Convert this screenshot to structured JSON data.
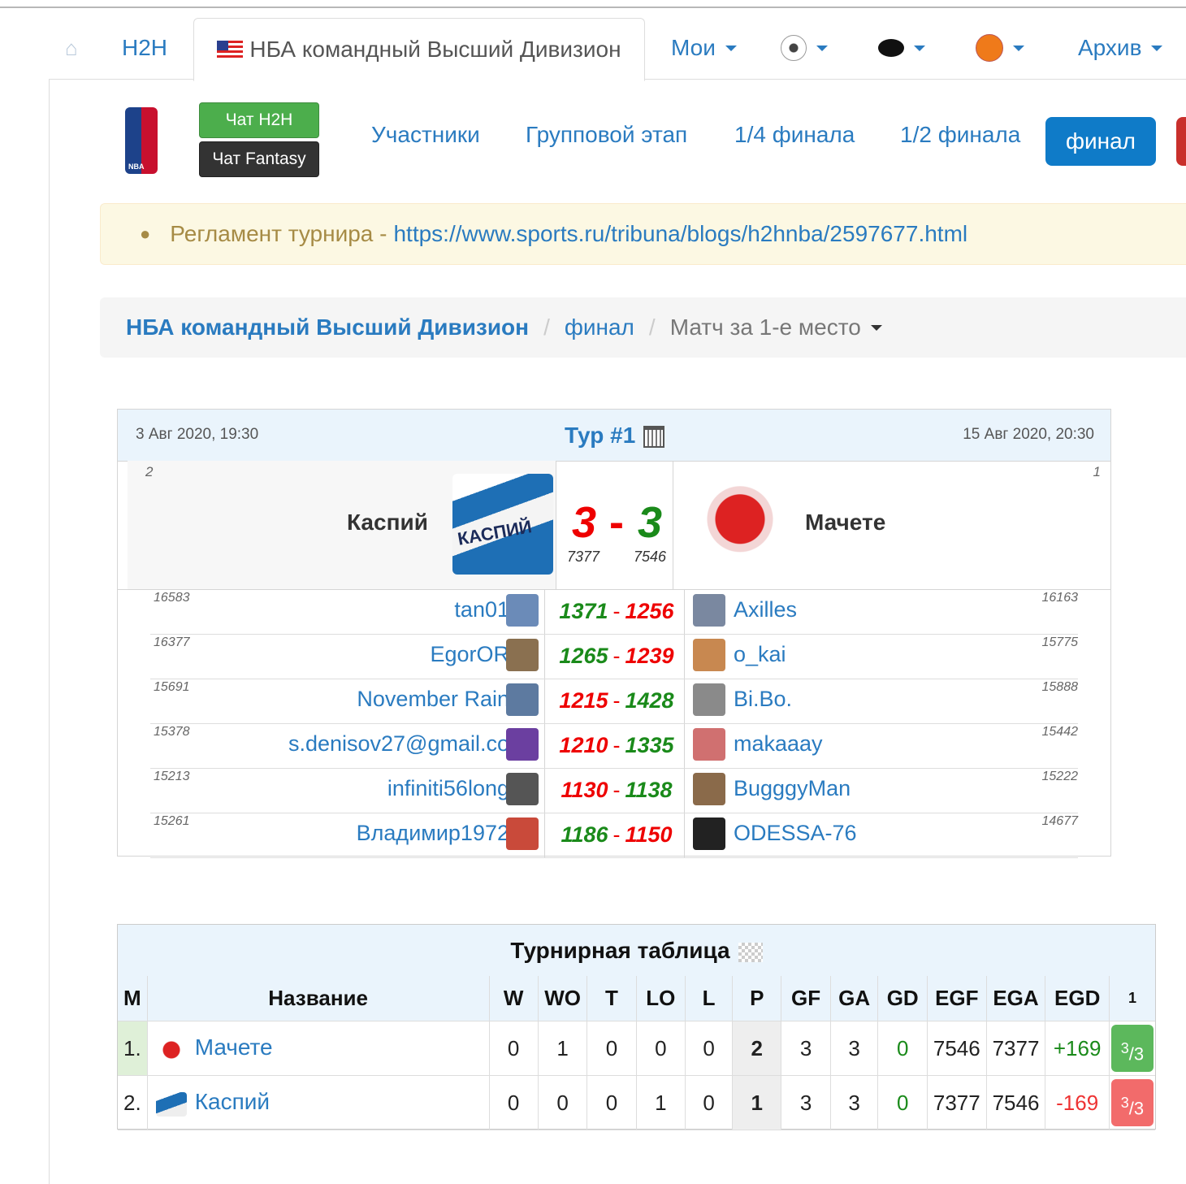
{
  "nav": {
    "h2h": "H2H",
    "active_tab": "НБА командный Высший Дивизион",
    "moi": "Мои",
    "archive": "Архив"
  },
  "toolbar": {
    "chat_h2h": "Чат H2H",
    "chat_fantasy": "Чат Fantasy",
    "participants": "Участники",
    "group_stage": "Групповой этап",
    "quarter": "1/4 финала",
    "semi": "1/2 финала",
    "final": "финал"
  },
  "alert": {
    "label": "Регламент турнира -",
    "link": "https://www.sports.ru/tribuna/blogs/h2hnba/2597677.html"
  },
  "breadcrumb": {
    "division": "НБА командный Высший Дивизион",
    "stage": "финал",
    "match": "Матч за 1-е место"
  },
  "match": {
    "start": "3 Авг 2020, 19:30",
    "end": "15 Авг 2020, 20:30",
    "tour": "Тур #1",
    "home": {
      "seed": "2",
      "name": "Каспий",
      "score": "3",
      "total": "7377"
    },
    "away": {
      "seed": "1",
      "name": "Мачете",
      "score": "3",
      "total": "7546"
    },
    "pairs": [
      {
        "lr": "16583",
        "left": "tan01",
        "ls": "1371",
        "rs": "1256",
        "right": "Axilles",
        "rr": "16163",
        "lwin": true
      },
      {
        "lr": "16377",
        "left": "EgorOR",
        "ls": "1265",
        "rs": "1239",
        "right": "o_kai",
        "rr": "15775",
        "lwin": true
      },
      {
        "lr": "15691",
        "left": "November Rain",
        "ls": "1215",
        "rs": "1428",
        "right": "Bi.Bo.",
        "rr": "15888",
        "lwin": false
      },
      {
        "lr": "15378",
        "left": "s.denisov27@gmail.co",
        "ls": "1210",
        "rs": "1335",
        "right": "makaaay",
        "rr": "15442",
        "lwin": false
      },
      {
        "lr": "15213",
        "left": "infiniti56long",
        "ls": "1130",
        "rs": "1138",
        "right": "BugggyMan",
        "rr": "15222",
        "lwin": false
      },
      {
        "lr": "15261",
        "left": "Владимир1972",
        "ls": "1186",
        "rs": "1150",
        "right": "ODESSA-76",
        "rr": "14677",
        "lwin": true
      }
    ]
  },
  "standings": {
    "title": "Турнирная таблица",
    "headers": [
      "М",
      "Название",
      "W",
      "WO",
      "T",
      "LO",
      "L",
      "P",
      "GF",
      "GA",
      "GD",
      "EGF",
      "EGA",
      "EGD",
      "1"
    ],
    "rows": [
      {
        "pos": "1.",
        "name": "Мачете",
        "W": "0",
        "WO": "1",
        "T": "0",
        "LO": "0",
        "L": "0",
        "P": "2",
        "GF": "3",
        "GA": "3",
        "GD": "0",
        "EGF": "7546",
        "EGA": "7377",
        "EGD": "+169",
        "badge_num": "3",
        "badge_den": "3"
      },
      {
        "pos": "2.",
        "name": "Каспий",
        "W": "0",
        "WO": "0",
        "T": "0",
        "LO": "1",
        "L": "0",
        "P": "1",
        "GF": "3",
        "GA": "3",
        "GD": "0",
        "EGF": "7377",
        "EGA": "7546",
        "EGD": "-169",
        "badge_num": "3",
        "badge_den": "3"
      }
    ]
  },
  "colors": {
    "link": "#2a7bc0",
    "win": "#1a8a1a",
    "loss": "#e00"
  }
}
